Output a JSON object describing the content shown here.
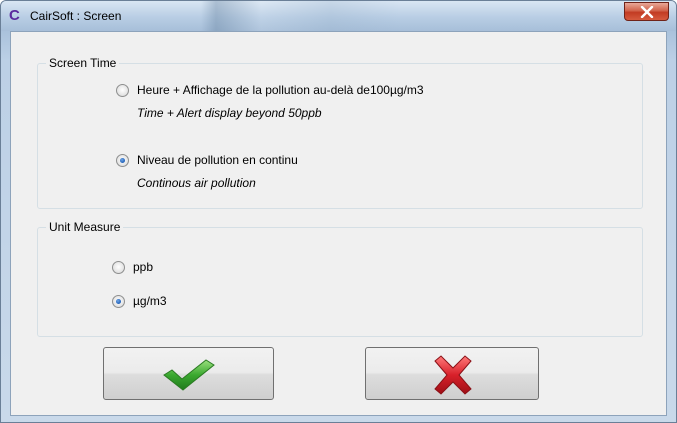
{
  "window": {
    "title": "CairSoft : Screen",
    "app_icon_glyph": "C",
    "close_icon": "close-x-icon"
  },
  "screen_time": {
    "group_label": "Screen Time",
    "options": [
      {
        "label": "Heure + Affichage de la pollution au-delà de100µg/m3",
        "subtitle": "Time + Alert display beyond 50ppb",
        "checked": false
      },
      {
        "label": "Niveau de pollution en continu",
        "subtitle": "Continous air pollution",
        "checked": true
      }
    ]
  },
  "unit_measure": {
    "group_label": "Unit Measure",
    "options": [
      {
        "label": "ppb",
        "checked": false
      },
      {
        "label": "µg/m3",
        "checked": true
      }
    ]
  },
  "buttons": {
    "ok_icon": "green-checkmark-icon",
    "cancel_icon": "red-x-icon"
  },
  "colors": {
    "ok_green": "#3aa82f",
    "cancel_red": "#d8202a",
    "radio_selected": "#1f5fb8"
  }
}
